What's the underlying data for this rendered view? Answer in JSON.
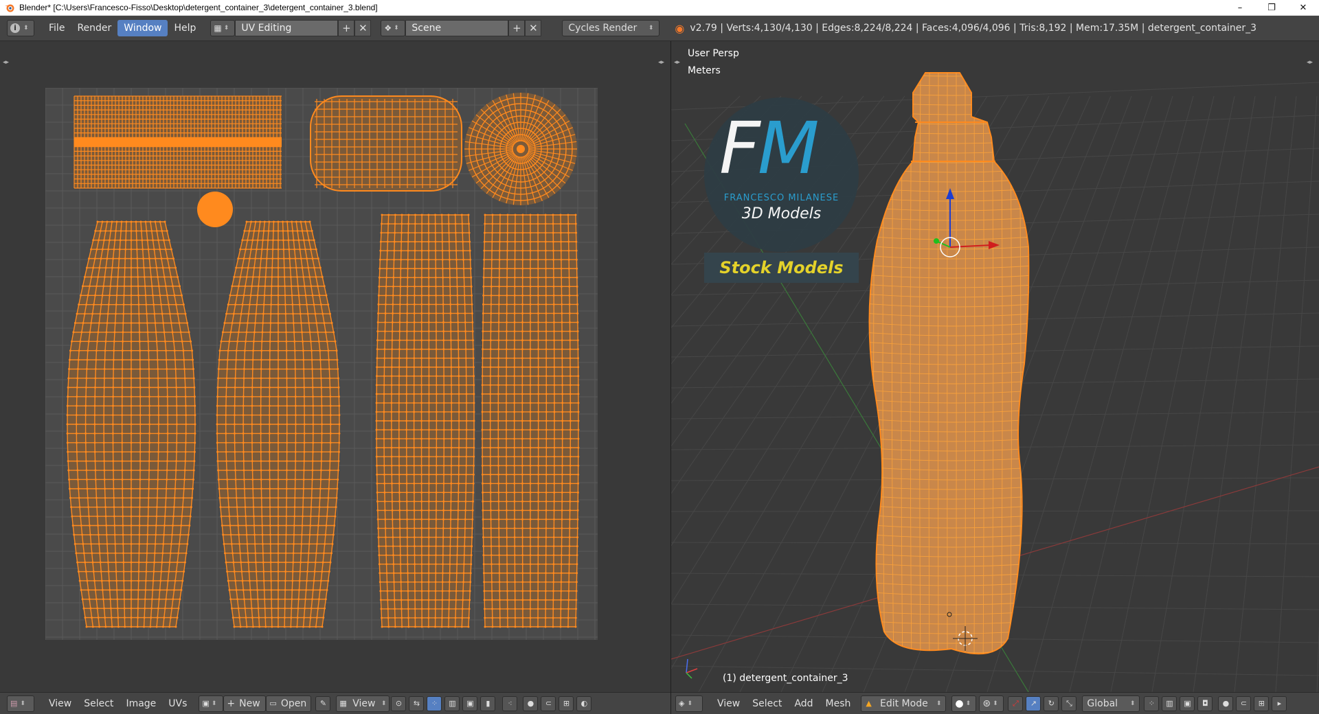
{
  "window": {
    "title": "Blender* [C:\\Users\\Francesco-Fisso\\Desktop\\detergent_container_3\\detergent_container_3.blend]",
    "minimize": "–",
    "maximize": "❐",
    "close": "✕"
  },
  "info_header": {
    "menus": [
      "File",
      "Render",
      "Window",
      "Help"
    ],
    "active_menu": "Window",
    "screen_layout": "UV Editing",
    "scene": "Scene",
    "render_engine": "Cycles Render",
    "stats": "v2.79 | Verts:4,130/4,130 | Edges:8,224/8,224 | Faces:4,096/4,096 | Tris:8,192 | Mem:17.35M | detergent_container_3"
  },
  "viewport": {
    "view_name": "User Persp",
    "units": "Meters",
    "object_label": "(1) detergent_container_3"
  },
  "watermark": {
    "brand": "FRANCESCO MILANESE",
    "tagline": "3D Models",
    "banner": "Stock Models"
  },
  "uv_bottom_bar": {
    "menus": [
      "View",
      "Select",
      "Image",
      "UVs"
    ],
    "new_label": "New",
    "open_label": "Open",
    "view_label": "View"
  },
  "v3d_bottom_bar": {
    "menus": [
      "View",
      "Select",
      "Add",
      "Mesh"
    ],
    "mode": "Edit Mode",
    "orientation": "Global"
  },
  "colors": {
    "accent": "#5680c2",
    "uv_orange": "#ff8a1e",
    "mesh_fill": "#c9874a",
    "background": "#393939"
  }
}
